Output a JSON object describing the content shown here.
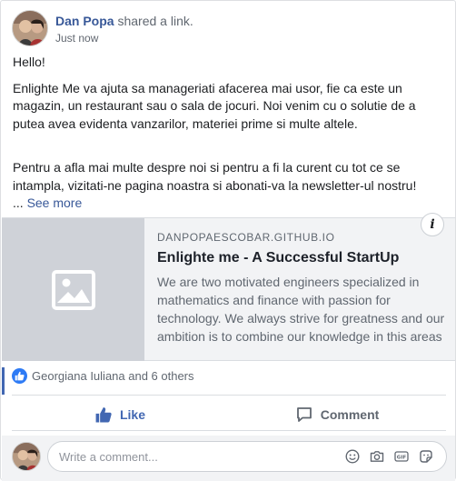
{
  "post": {
    "author": "Dan Popa",
    "action": "shared a",
    "action_link": "link.",
    "timestamp": "Just now",
    "greeting": "Hello!",
    "paragraph1": "Enlighte Me va ajuta sa manageriati afacerea mai usor, fie ca este un magazin, un restaurant sau o sala de jocuri. Noi venim cu o solutie de a putea avea evidenta vanzarilor, materiei prime si multe altele.",
    "paragraph2": "Pentru a afla mai multe despre noi si pentru a fi la curent cu tot ce se intampla, vizitati-ne pagina noastra si abonati-va la newsletter-ul nostru!",
    "ellipsis": "...",
    "see_more": "See more"
  },
  "link_preview": {
    "domain": "DANPOPAESCOBAR.GITHUB.IO",
    "title": "Enlighte me - A Successful StartUp",
    "description": "We are two motivated engineers specialized in mathematics and finance with passion for technology. We always strive for greatness and our ambition is to combine our knowledge in this areas",
    "info_icon": "i"
  },
  "reactions": {
    "summary": "Georgiana Iuliana and 6 others",
    "icon": "thumbs-up-icon"
  },
  "actions": {
    "like_label": "Like",
    "comment_label": "Comment"
  },
  "comment_box": {
    "placeholder": "Write a comment...",
    "icons": [
      "emoji-icon",
      "camera-icon",
      "gif-icon",
      "sticker-icon"
    ]
  },
  "colors": {
    "link_blue": "#385898",
    "like_blue": "#4267b2",
    "reaction_blue": "#2e7bf5"
  }
}
